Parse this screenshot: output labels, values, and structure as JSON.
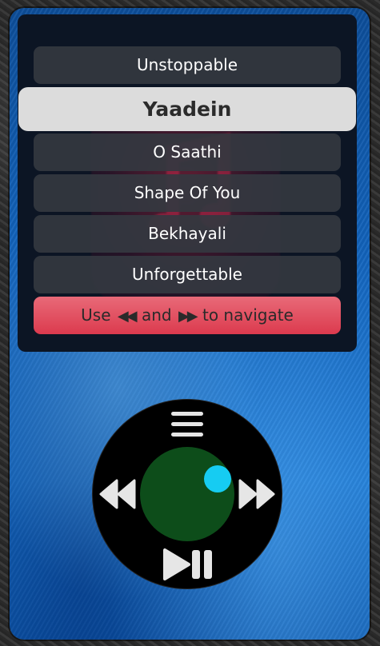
{
  "songs": [
    {
      "title": "Unstoppable"
    },
    {
      "title": "Yaadein"
    },
    {
      "title": "O Saathi"
    },
    {
      "title": "Shape Of You"
    },
    {
      "title": "Bekhayali"
    },
    {
      "title": "Unforgettable"
    }
  ],
  "selected_index": 1,
  "hint": {
    "prefix": "Use",
    "prev_glyph": "◀◀",
    "middle": "and",
    "next_glyph": "▶▶",
    "suffix": "to navigate"
  },
  "icons": {
    "background": "music-note-icon",
    "menu": "menu-icon",
    "prev": "rewind-icon",
    "next": "fast-forward-icon",
    "playpause": "play-pause-icon"
  },
  "colors": {
    "screen": "#0c1524",
    "song_item": "#343840",
    "selected_item": "#dcdcdc",
    "hint": "#dc3a4e",
    "wheel": "#000000",
    "center": "#0d4d1a",
    "knob": "#16ccf2",
    "device": "#1367c2"
  }
}
